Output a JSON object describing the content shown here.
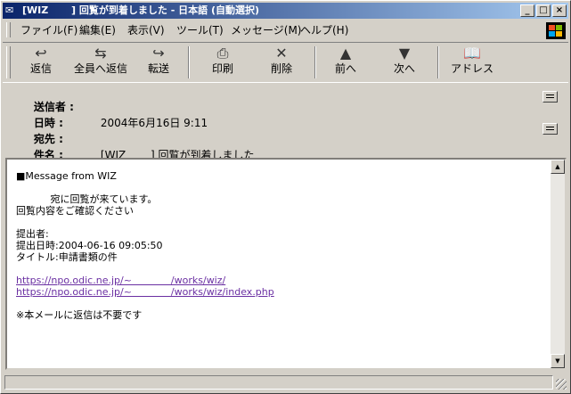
{
  "window": {
    "title": "[WIZ　　 ] 回覧が到着しました - 日本語 (自動選択)",
    "controls": [
      "_",
      "□",
      "×"
    ]
  },
  "menu": [
    {
      "label": "ファイル(F)"
    },
    {
      "label": "編集(E)"
    },
    {
      "label": "表示(V)"
    },
    {
      "label": "ツール(T)"
    },
    {
      "label": "メッセージ(M)"
    },
    {
      "label": "ヘルプ(H)"
    }
  ],
  "toolbar": [
    {
      "label": "返信",
      "icon": "reply-icon",
      "glyph": "↩"
    },
    {
      "label": "全員へ返信",
      "icon": "reply-all-icon",
      "glyph": "⇆"
    },
    {
      "label": "転送",
      "icon": "forward-icon",
      "glyph": "↪"
    },
    {
      "label": "印刷",
      "icon": "print-icon",
      "glyph": "⎙"
    },
    {
      "label": "削除",
      "icon": "delete-icon",
      "glyph": "✕"
    },
    {
      "label": "前へ",
      "icon": "previous-icon",
      "glyph": "▲"
    },
    {
      "label": "次へ",
      "icon": "next-icon",
      "glyph": "▼"
    },
    {
      "label": "アドレス",
      "icon": "address-book-icon",
      "glyph": "📖"
    }
  ],
  "headers": {
    "from_label": "送信者 :",
    "from_value": "",
    "date_label": "日時 :",
    "date_value": "2004年6月16日 9:11",
    "to_label": "宛先 :",
    "to_value": "",
    "subject_label": "件名 :",
    "subject_value": "[WIZ　　 ] 回覧が到着しました"
  },
  "message": {
    "line1": "■Message from WIZ",
    "line2": "",
    "line3": "           宛に回覧が来ています。",
    "line4": "回覧内容をご確認ください",
    "line5": "",
    "line6": "提出者:",
    "line7": "提出日時:2004-06-16 09:05:50",
    "line8": "タイトル:申請書類の件",
    "line9": "",
    "link1": "https://npo.odic.ne.jp/~　　　　/works/wiz/",
    "link2": "https://npo.odic.ne.jp/~　　　　/works/wiz/index.php",
    "line12": "",
    "line13": "※本メールに返信は不要です"
  }
}
